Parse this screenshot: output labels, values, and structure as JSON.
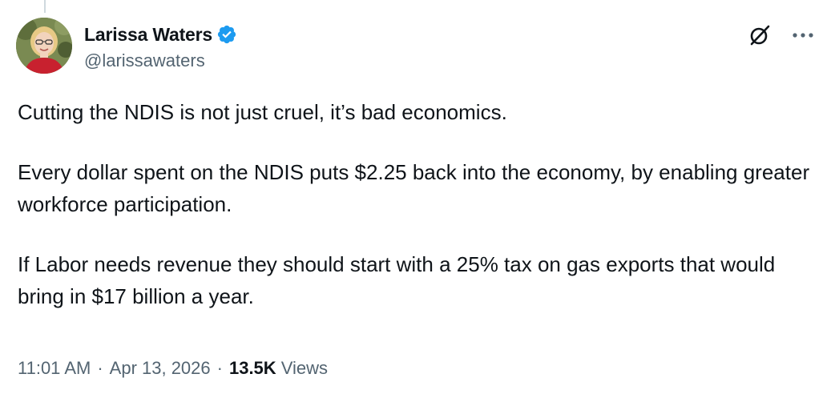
{
  "author": {
    "display_name": "Larissa Waters",
    "handle": "@larissawaters",
    "verified": true,
    "verified_color": "#1d9bf0"
  },
  "tweet": {
    "paragraphs": [
      "Cutting the NDIS is not just cruel, it’s bad economics.",
      "Every dollar spent on the NDIS puts $2.25 back into the economy, by enabling greater workforce participation.",
      "If Labor needs revenue they should start with a 25% tax on gas exports that would bring in $17 billion a year."
    ]
  },
  "meta": {
    "time": "11:01 AM",
    "separator": "·",
    "date": "Apr 13, 2026",
    "views_count": "13.5K",
    "views_label": "Views"
  },
  "icons": {
    "grok": "grok-icon",
    "more": "more-icon",
    "verified": "verified-badge-icon"
  },
  "colors": {
    "text_primary": "#0f1419",
    "text_secondary": "#536471",
    "thread_line": "#cfd9de"
  }
}
